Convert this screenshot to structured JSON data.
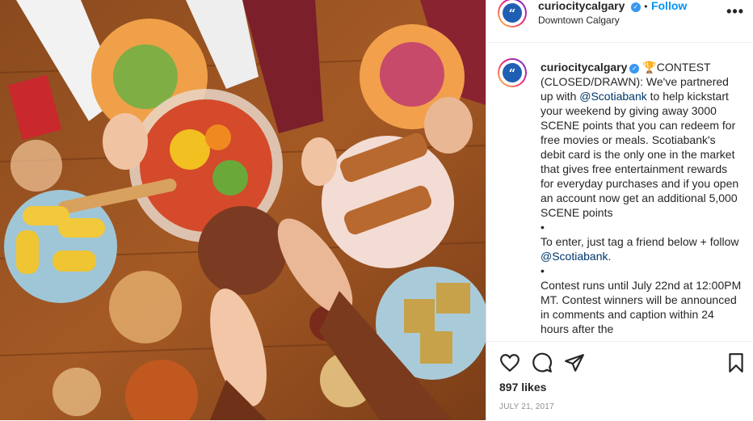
{
  "post": {
    "username": "curiocitycalgary",
    "follow_label": "Follow",
    "separator": "•",
    "location": "Downtown Calgary",
    "more_icon": "•••"
  },
  "caption": {
    "username": "curiocitycalgary",
    "emoji": "🏆",
    "part1": "CONTEST (CLOSED/DRAWN): We've partnered up with ",
    "mention1": "@Scotiabank",
    "part2": " to help kickstart your weekend by giving away 3000 SCENE points that you can redeem for free movies or meals. Scotiabank's debit card is the only one in the market that gives free entertainment rewards for everyday purchases and if you open an account now get an additional 5,000 SCENE points\n•\nTo enter, just tag a friend below + follow ",
    "mention2": "@Scotiabank",
    "part3": ".\n•\nContest runs until July 22nd at 12:00PM MT. Contest winners will be announced in comments and caption within 24 hours after the"
  },
  "engagement": {
    "likes": "897 likes",
    "date": "JULY 21, 2017"
  },
  "icons": {
    "like": "heart-icon",
    "comment": "comment-icon",
    "share": "paper-plane-icon",
    "save": "bookmark-icon"
  },
  "colors": {
    "link": "#0095f6",
    "mention": "#00376b",
    "verified": "#3897f0",
    "muted": "#8e8e8e"
  }
}
